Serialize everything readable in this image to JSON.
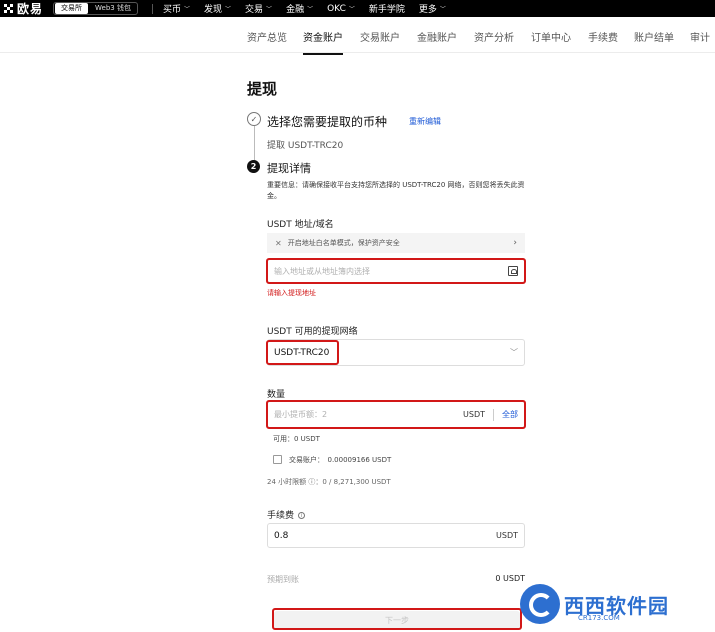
{
  "topbar": {
    "logo_text": "欧易",
    "pills": [
      "交易所",
      "Web3 钱包"
    ],
    "nav": [
      {
        "label": "买币",
        "chevron": true
      },
      {
        "label": "发现",
        "chevron": true
      },
      {
        "label": "交易",
        "chevron": true
      },
      {
        "label": "金融",
        "chevron": true
      },
      {
        "label": "OKC",
        "chevron": true
      },
      {
        "label": "新手学院",
        "chevron": false
      },
      {
        "label": "更多",
        "chevron": true
      }
    ]
  },
  "subnav": {
    "items": [
      "资产总览",
      "资金账户",
      "交易账户",
      "金融账户",
      "资产分析",
      "订单中心",
      "手续费",
      "账户结单",
      "审计"
    ],
    "active": "资金账户"
  },
  "page_title": "提现",
  "step1": {
    "number": "✓",
    "title": "选择您需要提取的币种",
    "edit_label": "重新编辑",
    "selected": "提取 USDT-TRC20"
  },
  "step2": {
    "number": "2",
    "title": "提现详情",
    "notice": "重要信息：请确保接收平台支持您所选择的 USDT-TRC20 网络，否则您将丢失此资金。"
  },
  "address": {
    "label": "USDT 地址/域名",
    "whitelist_text": "开启地址白名单模式，保护资产安全",
    "placeholder": "输入地址或从地址簿内选择",
    "error": "请输入提现地址"
  },
  "network": {
    "label": "USDT 可用的提现网络",
    "value": "USDT-TRC20"
  },
  "amount": {
    "label": "数量",
    "placeholder": "最小提币额：2",
    "unit": "USDT",
    "all_label": "全部",
    "available": "可用：0 USDT",
    "trading_account": "交易账户：　0.00009166 USDT",
    "limit": "24 小时限额 ⓘ：0 / 8,271,300 USDT"
  },
  "fee": {
    "label": "手续费",
    "info": "i",
    "value": "0.8",
    "unit": "USDT"
  },
  "receive": {
    "label": "预期到账",
    "value": "0 USDT"
  },
  "next_button": "下一步",
  "watermark": {
    "text": "西西软件园",
    "sub": "CR173.COM"
  },
  "colors": {
    "accent_blue": "#1c58d6",
    "highlight_red": "#d21818",
    "watermark_blue": "#2d6fd0"
  }
}
